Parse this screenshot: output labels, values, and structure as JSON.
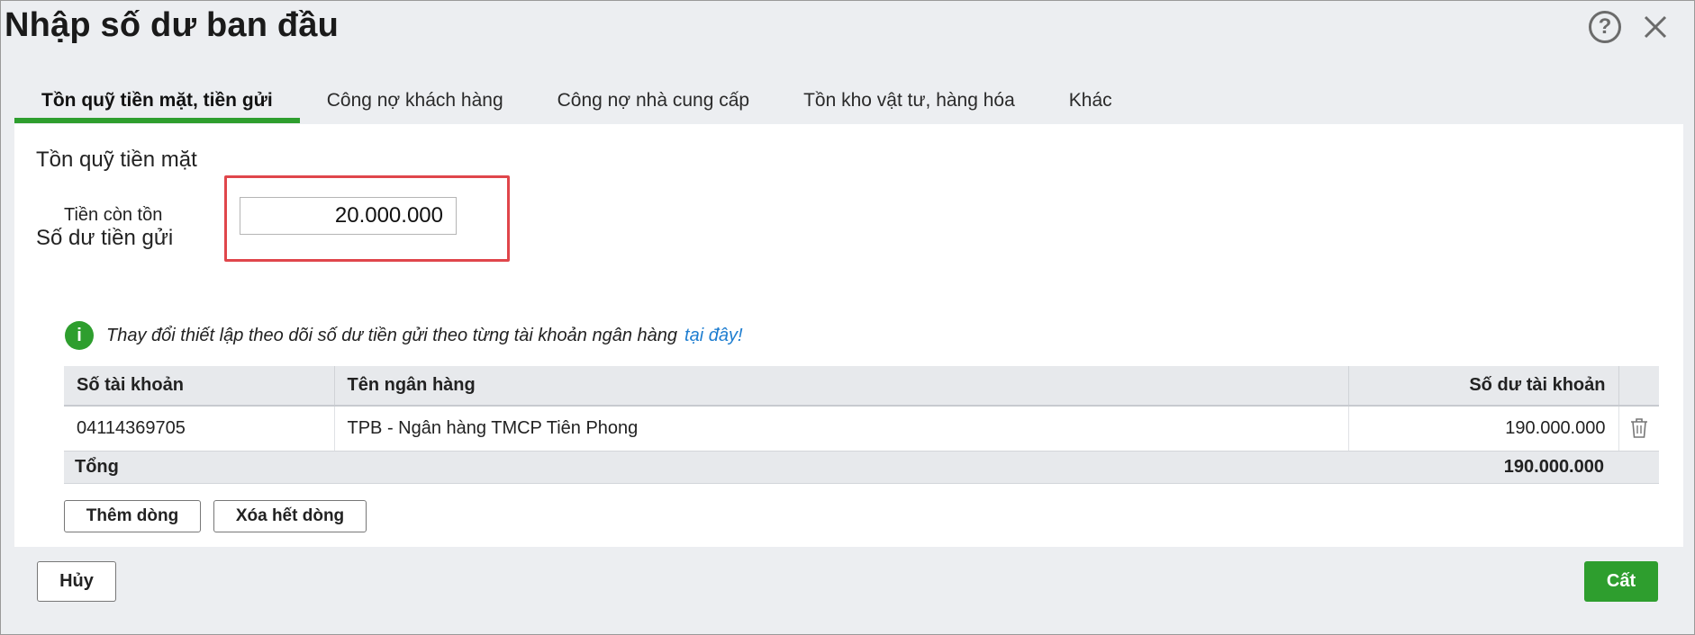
{
  "dialog": {
    "title": "Nhập số dư ban đầu",
    "help_symbol": "?"
  },
  "tabs": [
    {
      "label": "Tồn quỹ tiền mặt, tiền gửi",
      "active": true
    },
    {
      "label": "Công nợ khách hàng",
      "active": false
    },
    {
      "label": "Công nợ nhà cung cấp",
      "active": false
    },
    {
      "label": "Tồn kho vật tư, hàng hóa",
      "active": false
    },
    {
      "label": "Khác",
      "active": false
    }
  ],
  "cash": {
    "section_title": "Tồn quỹ tiền mặt",
    "field_label": "Tiền còn tồn",
    "field_value": "20.000.000"
  },
  "deposit": {
    "section_title": "Số dư tiền gửi",
    "info_icon": "i",
    "info_text": "Thay đổi thiết lập theo dõi số dư tiền gửi theo từng tài khoản ngân hàng",
    "info_link": "tại đây!"
  },
  "table": {
    "headers": [
      "Số tài khoản",
      "Tên ngân hàng",
      "Số dư tài khoản"
    ],
    "rows": [
      {
        "account": "04114369705",
        "bank": "TPB - Ngân hàng TMCP Tiên Phong",
        "balance": "190.000.000"
      }
    ],
    "total_label": "Tổng",
    "total_value": "190.000.000"
  },
  "actions": {
    "add_row": "Thêm dòng",
    "clear_rows": "Xóa hết dòng"
  },
  "footer": {
    "cancel": "Hủy",
    "save": "Cất"
  },
  "colors": {
    "accent": "#2e9e2e",
    "link": "#1f7ed0",
    "highlight": "#e0464b"
  }
}
